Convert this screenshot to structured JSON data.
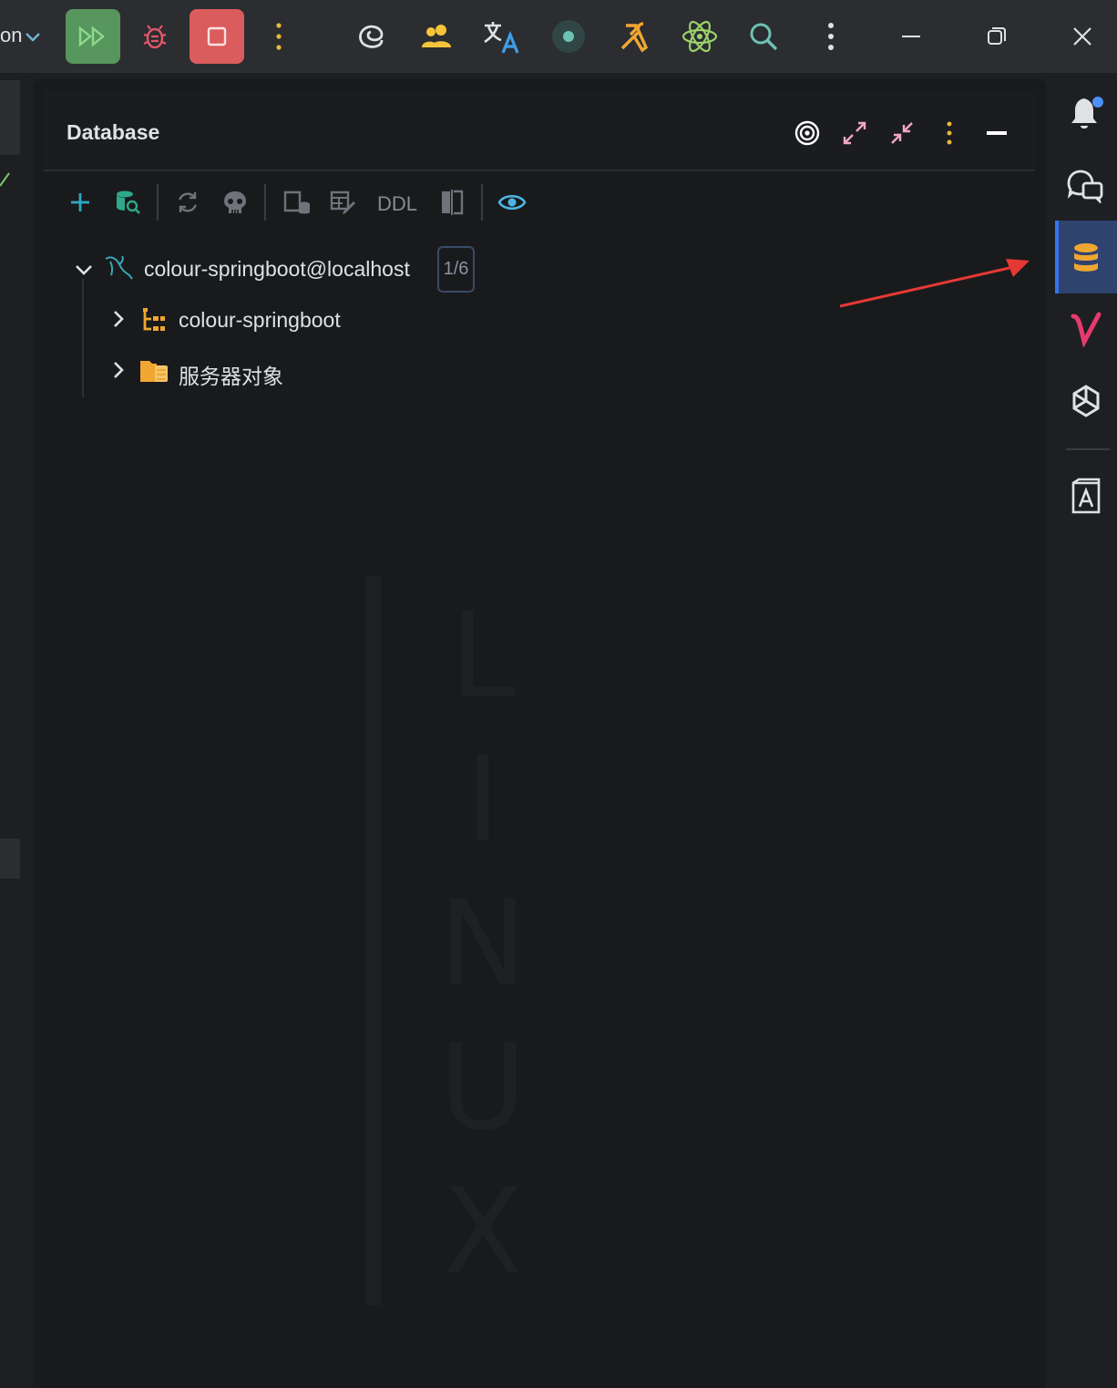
{
  "titlebar": {
    "run_config_tail": "on",
    "icons": [
      "chevron-down-icon",
      "run-icon",
      "debug-icon",
      "stop-icon",
      "more-vertical-icon",
      "swirl-icon",
      "users-icon",
      "translate-icon",
      "record-icon",
      "build-icon",
      "atom-icon",
      "search-icon",
      "more-vertical-icon",
      "minimize-icon",
      "restore-icon",
      "close-icon"
    ]
  },
  "database_panel": {
    "title": "Database",
    "header_actions": [
      "target-icon",
      "expand-icon",
      "collapse-icon",
      "more-vertical-icon",
      "minimize-panel-icon"
    ],
    "toolbar": {
      "ddl_label": "DDL",
      "tools": [
        "add-icon",
        "db-search-icon",
        "refresh-icon",
        "skull-icon",
        "db-script-icon",
        "table-edit-icon",
        "compare-icon",
        "eye-icon"
      ]
    },
    "tree": {
      "connection": {
        "label": "colour-springboot@localhost",
        "badge": "1/6",
        "expanded": true
      },
      "children": [
        {
          "label": "colour-springboot",
          "icon": "schema-icon"
        },
        {
          "label": "服务器对象",
          "icon": "folder-icon"
        }
      ]
    },
    "watermark_letters": [
      "L",
      "I",
      "N",
      "U",
      "X"
    ]
  },
  "right_strip": {
    "items": [
      "bell-icon",
      "chat-icon",
      "database-icon",
      "v-logo-icon",
      "openai-icon",
      "dictionary-icon"
    ],
    "active": "database-icon",
    "notification_dot_color": "#4f8ff7"
  },
  "colors": {
    "accent": "#3574f0",
    "annotation_arrow": "#e53935",
    "run": "#57965c",
    "stop": "#db5c5c"
  }
}
